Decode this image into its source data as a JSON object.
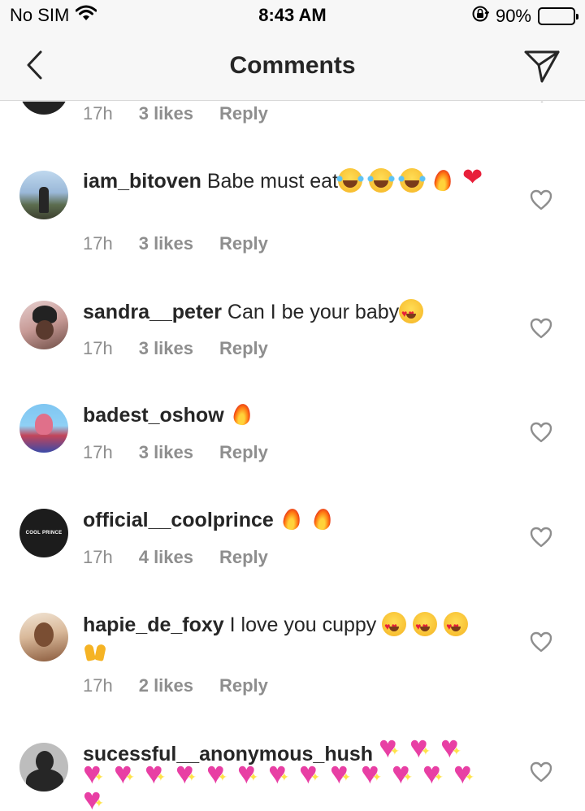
{
  "status_bar": {
    "carrier": "No SIM",
    "time": "8:43 AM",
    "battery_percent": "90%",
    "battery_level": 0.9
  },
  "nav": {
    "title": "Comments",
    "back_icon": "chevron-left-icon",
    "send_icon": "direct-send-icon"
  },
  "comments": [
    {
      "username": "",
      "text": "",
      "time": "17h",
      "likes": "3 likes",
      "reply": "Reply",
      "avatar": "dark"
    },
    {
      "username": "iam_bitoven",
      "text": "Babe must eat",
      "emojis": [
        "joy",
        "joy",
        "joy",
        "fire",
        "heart"
      ],
      "time": "17h",
      "likes": "3 likes",
      "reply": "Reply",
      "avatar": "bitoven"
    },
    {
      "username": "sandra__peter",
      "text": "Can I be your baby",
      "emojis": [
        "heart-eyes"
      ],
      "time": "17h",
      "likes": "3 likes",
      "reply": "Reply",
      "avatar": "sandra"
    },
    {
      "username": "badest_oshow",
      "text": "",
      "emojis": [
        "fire"
      ],
      "time": "17h",
      "likes": "3 likes",
      "reply": "Reply",
      "avatar": "oshow"
    },
    {
      "username": "official__coolprince",
      "text": "",
      "emojis": [
        "fire",
        "fire"
      ],
      "time": "17h",
      "likes": "4 likes",
      "reply": "Reply",
      "avatar": "cool",
      "avatar_text": "COOL PRINCE"
    },
    {
      "username": "hapie_de_foxy",
      "text": "I love you cuppy",
      "emojis": [
        "heart-eyes",
        "heart-eyes",
        "heart-eyes",
        "hands"
      ],
      "time": "17h",
      "likes": "2 likes",
      "reply": "Reply",
      "avatar": "foxy"
    },
    {
      "username": "sucessful__anonymous_hush",
      "text": "",
      "emojis": [
        "sparkle",
        "sparkle",
        "sparkle",
        "sparkle",
        "sparkle",
        "sparkle",
        "sparkle",
        "sparkle",
        "sparkle",
        "sparkle",
        "sparkle",
        "sparkle",
        "sparkle",
        "sparkle",
        "sparkle",
        "sparkle",
        "sparkle"
      ],
      "avatar": "hush"
    }
  ]
}
